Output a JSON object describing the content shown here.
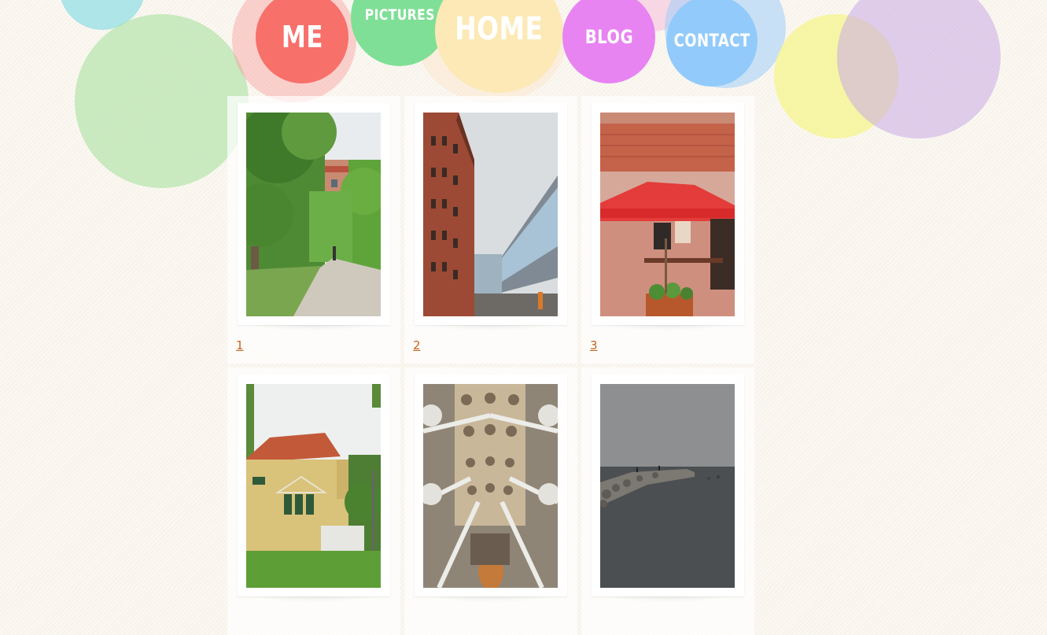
{
  "nav": {
    "me": "ME",
    "pictures": "PICTURES",
    "home": "HOME",
    "blog": "BLOG",
    "contact": "CONTACT"
  },
  "gallery": {
    "items": [
      {
        "label": "1",
        "subject": "tree-lined path with building"
      },
      {
        "label": "2",
        "subject": "red brick building and glass walkway"
      },
      {
        "label": "3",
        "subject": "cafe terrace with red umbrella"
      },
      {
        "label": "",
        "subject": "yellow villa with red roof"
      },
      {
        "label": "",
        "subject": "cathedral ceiling vaults"
      },
      {
        "label": "",
        "subject": "stone pier at grey sea"
      }
    ]
  },
  "colors": {
    "me": "#f7706a",
    "pictures": "#7fdf96",
    "home": "#fce9b6",
    "blog": "#e883f2",
    "contact": "#92cbfb",
    "link": "#c7631d"
  }
}
